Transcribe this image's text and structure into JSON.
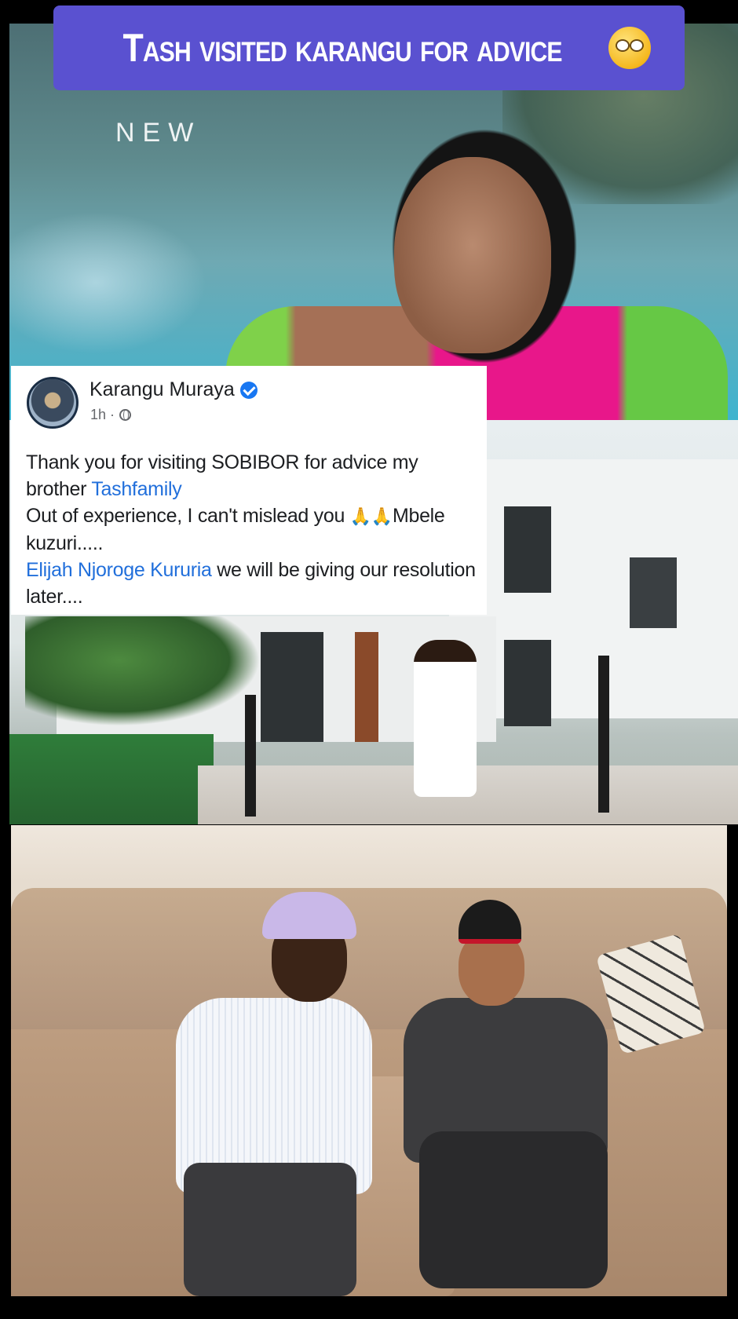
{
  "banner": {
    "title": "Tash visited karangu for advice",
    "emoji": "eye-roll-emoji"
  },
  "scene_pool": {
    "watermark": "NEW"
  },
  "post": {
    "author": "Karangu Muraya",
    "verified": true,
    "time": "1h ·",
    "privacy_icon": "globe-icon",
    "line1": "Thank you for visiting SOBIBOR for advice my brother ",
    "mention1": "Tashfamily",
    "line2": "Out of experience, I can't mislead you ",
    "pray": "🙏🙏",
    "line3": "Mbele kuzuri.....",
    "mention2": "Elijah Njoroge Kururia",
    "line4": " we will be giving our resolution later...."
  }
}
